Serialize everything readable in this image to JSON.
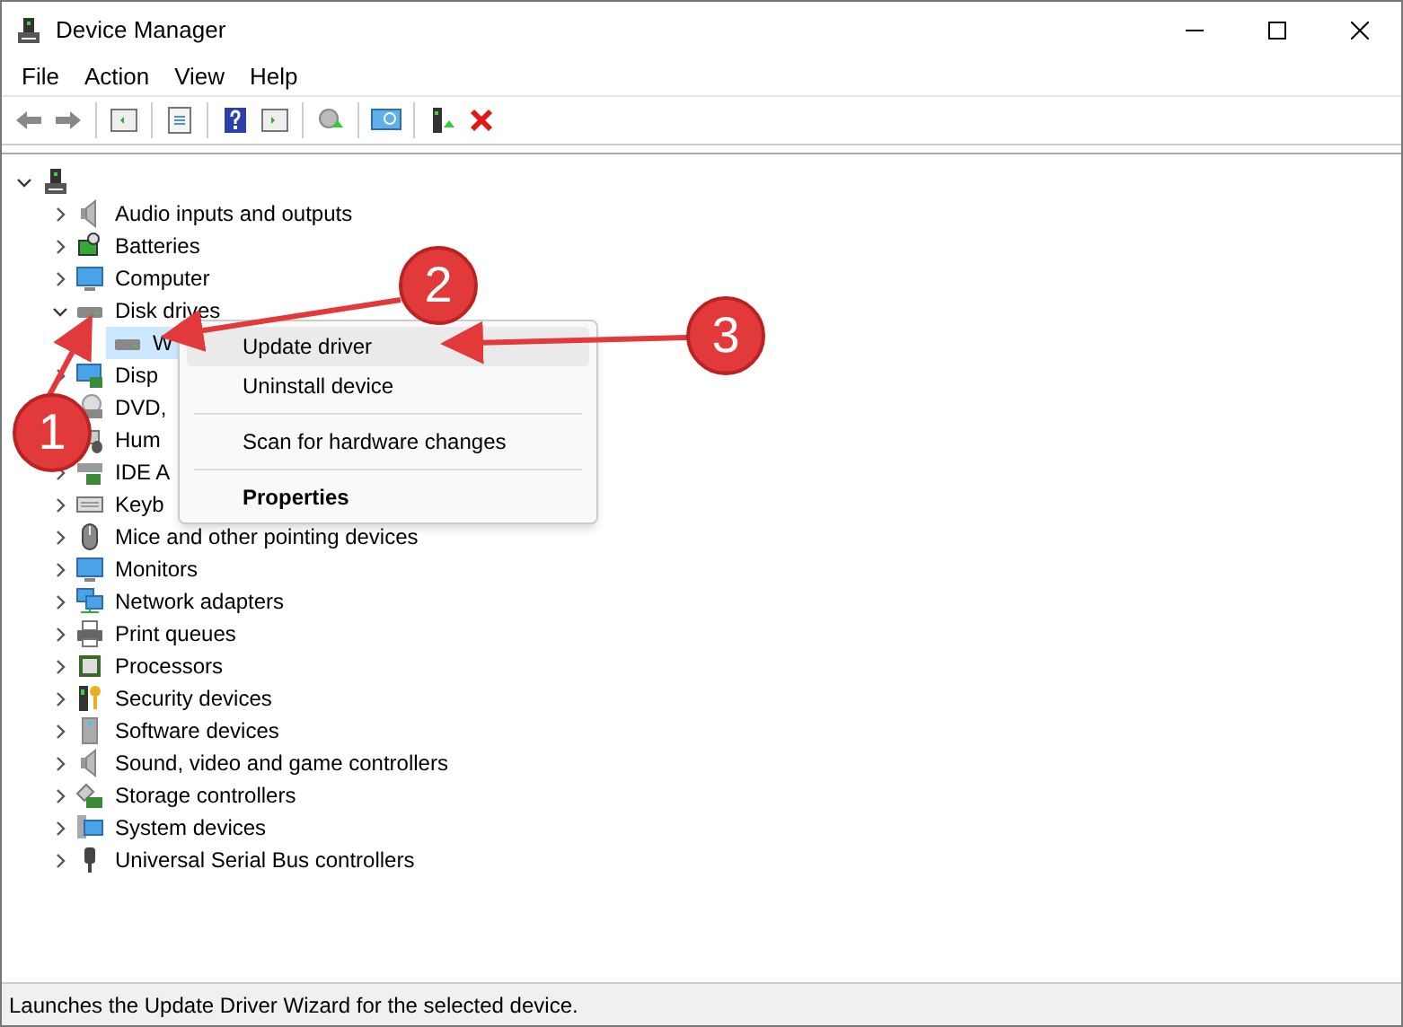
{
  "window": {
    "title": "Device Manager"
  },
  "menu": [
    "File",
    "Action",
    "View",
    "Help"
  ],
  "tree": {
    "expanded": true,
    "children": [
      {
        "label": "Audio inputs and outputs",
        "expanded": false
      },
      {
        "label": "Batteries",
        "expanded": false
      },
      {
        "label": "Computer",
        "expanded": false
      },
      {
        "label": "Disk drives",
        "expanded": true,
        "children": [
          {
            "label": "W",
            "selected": true
          }
        ]
      },
      {
        "label": "Disp",
        "expanded": false
      },
      {
        "label": "DVD,"
      },
      {
        "label": "Hum"
      },
      {
        "label": "IDE A",
        "expanded": false
      },
      {
        "label": "Keyb",
        "expanded": false
      },
      {
        "label": "Mice and other pointing devices",
        "expanded": false
      },
      {
        "label": "Monitors",
        "expanded": false
      },
      {
        "label": "Network adapters",
        "expanded": false
      },
      {
        "label": "Print queues",
        "expanded": false
      },
      {
        "label": "Processors",
        "expanded": false
      },
      {
        "label": "Security devices",
        "expanded": false
      },
      {
        "label": "Software devices",
        "expanded": false
      },
      {
        "label": "Sound, video and game controllers",
        "expanded": false
      },
      {
        "label": "Storage controllers",
        "expanded": false
      },
      {
        "label": "System devices",
        "expanded": false
      },
      {
        "label": "Universal Serial Bus controllers",
        "expanded": false
      }
    ]
  },
  "context_menu": [
    {
      "kind": "item",
      "label": "Update driver",
      "selected": true,
      "default": false
    },
    {
      "kind": "item",
      "label": "Uninstall device",
      "selected": false,
      "default": false
    },
    {
      "kind": "separator"
    },
    {
      "kind": "item",
      "label": "Scan for hardware changes",
      "selected": false,
      "default": false
    },
    {
      "kind": "separator"
    },
    {
      "kind": "item",
      "label": "Properties",
      "selected": false,
      "default": true
    }
  ],
  "annotations": [
    "1",
    "2",
    "3"
  ],
  "status_bar": "Launches the Update Driver Wizard for the selected device."
}
